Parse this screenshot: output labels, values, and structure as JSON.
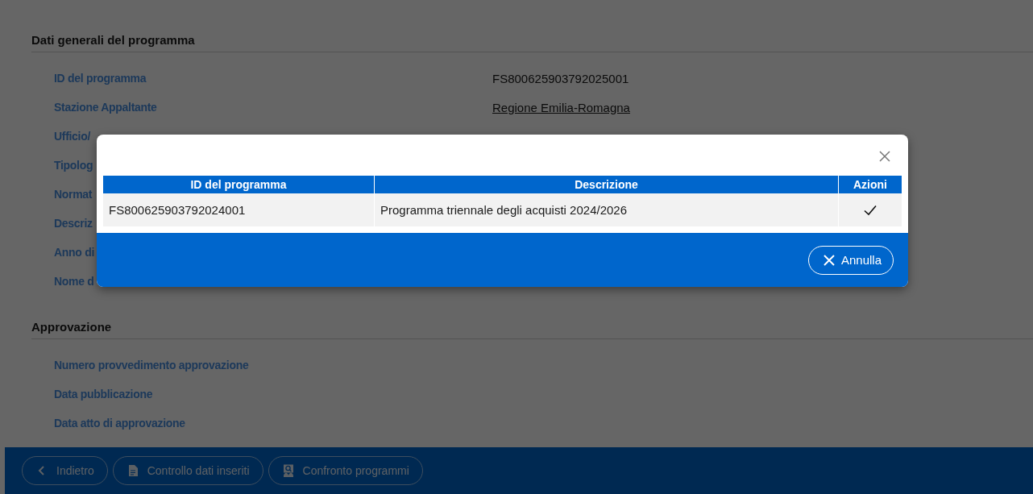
{
  "sections": [
    {
      "title": "Dati generali del programma",
      "fields": [
        {
          "label": "ID del programma",
          "value": "FS800625903792025001",
          "kind": "text"
        },
        {
          "label": "Stazione Appaltante",
          "value": "Regione Emilia-Romagna",
          "kind": "link"
        },
        {
          "label": "Ufficio/"
        },
        {
          "label": "Tipolog"
        },
        {
          "label": "Normat"
        },
        {
          "label": "Descriz"
        },
        {
          "label": "Anno di"
        },
        {
          "label": "Nome d"
        }
      ]
    },
    {
      "title": "Approvazione",
      "fields": [
        {
          "label": "Numero provvedimento approvazione"
        },
        {
          "label": "Data pubblicazione"
        },
        {
          "label": "Data atto di approvazione"
        }
      ]
    }
  ],
  "footer_buttons": [
    {
      "label": "Indietro",
      "kind": "back"
    },
    {
      "label": "Controllo dati inseriti",
      "kind": "document"
    },
    {
      "label": "Confronto programmi",
      "kind": "compare"
    }
  ],
  "modal": {
    "table": {
      "columns": [
        "ID del programma",
        "Descrizione",
        "Azioni"
      ],
      "rows": [
        {
          "cells": [
            "FS800625903792024001",
            "Programma triennale degli acquisti 2024/2026"
          ]
        }
      ]
    },
    "buttons": [
      {
        "label": "Annulla",
        "kind": "cancel"
      }
    ]
  }
}
